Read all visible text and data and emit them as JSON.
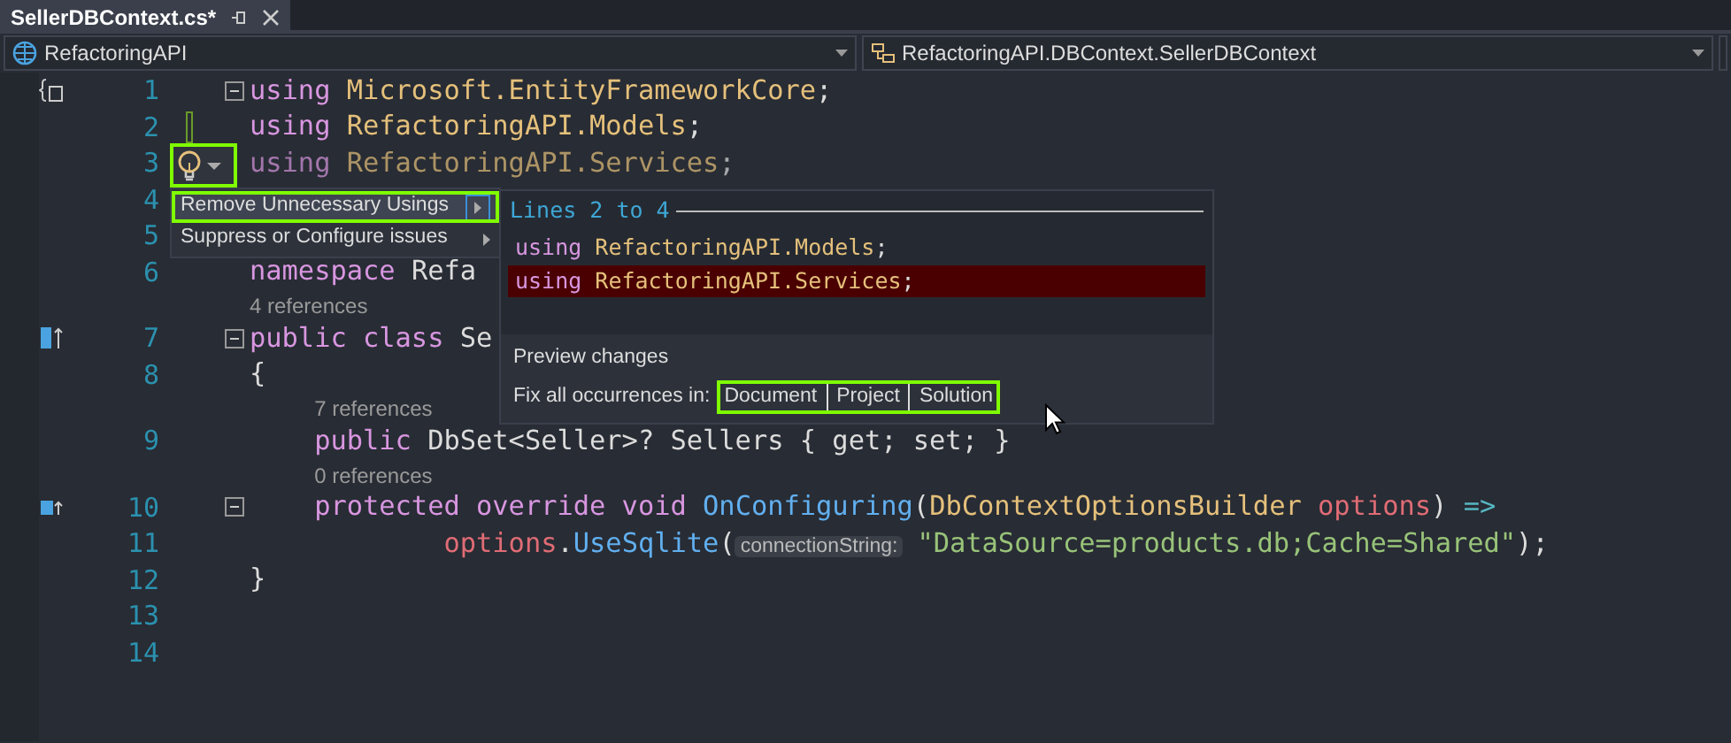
{
  "tab": {
    "title": "SellerDBContext.cs*",
    "selected": true
  },
  "navigation": {
    "project": "RefactoringAPI",
    "member": "RefactoringAPI.DBContext.SellerDBContext"
  },
  "lines": [
    {
      "kind": "code",
      "number": "1",
      "margin_icon": {
        "kind": "namespace"
      },
      "collapsible": true,
      "changed": false,
      "faded": false,
      "tokens": [
        {
          "kind": "keyword",
          "t": "using"
        },
        {
          "kind": "type",
          "t": " Microsoft.EntityFrameworkCore"
        },
        {
          "kind": "plain",
          "t": ";"
        }
      ]
    },
    {
      "kind": "code",
      "number": "2",
      "collapsible": false,
      "changed": true,
      "faded": false,
      "tokens": [
        {
          "kind": "keyword",
          "t": "using"
        },
        {
          "kind": "type",
          "t": " RefactoringAPI.Models"
        },
        {
          "kind": "plain",
          "t": ";"
        }
      ]
    },
    {
      "kind": "code",
      "number": "3",
      "collapsible": false,
      "changed": false,
      "faded": true,
      "tokens": [
        {
          "kind": "keyword",
          "t": "using"
        },
        {
          "kind": "type",
          "t": " RefactoringAPI.Services"
        },
        {
          "kind": "plain",
          "t": ";"
        }
      ]
    },
    {
      "kind": "code",
      "number": "4",
      "collapsible": false,
      "changed": false,
      "faded": false
    },
    {
      "kind": "code",
      "number": "5",
      "collapsible": false,
      "changed": false,
      "faded": false
    },
    {
      "kind": "code",
      "number": "6",
      "collapsible": false,
      "changed": false,
      "faded": false,
      "tokens": [
        {
          "kind": "keyword",
          "t": "namespace"
        },
        {
          "kind": "plain",
          "t": " Refa"
        }
      ]
    },
    {
      "kind": "lens",
      "text": "4 references"
    },
    {
      "kind": "code",
      "number": "7",
      "margin_icon": {
        "kind": "implemented"
      },
      "collapsible": true,
      "changed": false,
      "faded": false,
      "tokens": [
        {
          "kind": "keyword",
          "t": "public class"
        },
        {
          "kind": "plain",
          "t": " Se"
        }
      ]
    },
    {
      "kind": "code",
      "number": "8",
      "collapsible": false,
      "changed": false,
      "faded": false,
      "tokens": [
        {
          "kind": "plain",
          "t": "{"
        }
      ]
    },
    {
      "kind": "lens",
      "text": "    7 references"
    },
    {
      "kind": "code",
      "number": "9",
      "collapsible": false,
      "changed": false,
      "faded": false,
      "tokens": [
        {
          "kind": "keyword",
          "t": "    public"
        },
        {
          "kind": "plain",
          "t": " DbSet<Seller>? Sellers { get; set; }"
        }
      ]
    },
    {
      "kind": "lens",
      "text": "    0 references"
    },
    {
      "kind": "code",
      "number": "10",
      "margin_icon": {
        "kind": "override"
      },
      "collapsible": true,
      "changed": false,
      "faded": false,
      "tokens": [
        {
          "kind": "keyword",
          "t": "    protected override void"
        },
        {
          "kind": "method",
          "t": " OnConfiguring"
        },
        {
          "kind": "plain",
          "t": "("
        },
        {
          "kind": "type",
          "t": "DbContextOptionsBuilder"
        },
        {
          "kind": "param",
          "t": " options"
        },
        {
          "kind": "plain",
          "t": ") "
        },
        {
          "kind": "operator",
          "t": "=>"
        }
      ]
    },
    {
      "kind": "code",
      "number": "11",
      "collapsible": false,
      "changed": false,
      "faded": false,
      "tokens": [
        {
          "kind": "param",
          "t": "            options"
        },
        {
          "kind": "plain",
          "t": "."
        },
        {
          "kind": "method",
          "t": "UseSqlite"
        },
        {
          "kind": "plain",
          "t": "("
        },
        {
          "kind": "hint",
          "t": "connectionString:"
        },
        {
          "kind": "string",
          "t": "\"DataSource=products.db;Cache=Shared\""
        },
        {
          "kind": "plain",
          "t": ");"
        }
      ]
    },
    {
      "kind": "code",
      "number": "12",
      "collapsible": false,
      "changed": false,
      "faded": false,
      "tokens": [
        {
          "kind": "plain",
          "t": "}"
        }
      ]
    },
    {
      "kind": "code",
      "number": "13",
      "collapsible": false,
      "changed": false,
      "faded": false
    },
    {
      "kind": "code",
      "number": "14",
      "collapsible": false,
      "changed": false,
      "faded": false
    }
  ],
  "lightbulb": {
    "highlighted": true
  },
  "quick_actions": [
    {
      "label": "Remove Unnecessary Usings",
      "selected": true,
      "highlighted": true
    },
    {
      "label": "Suppress or Configure issues",
      "selected": false,
      "highlighted": false
    }
  ],
  "preview": {
    "heading": "Lines 2 to 4",
    "lines": [
      {
        "removed": false,
        "tokens": [
          {
            "kind": "keyword",
            "t": "using"
          },
          {
            "kind": "type",
            "t": " RefactoringAPI.Models"
          },
          {
            "kind": "plain",
            "t": ";"
          }
        ]
      },
      {
        "removed": true,
        "tokens": [
          {
            "kind": "keyword",
            "t": "using"
          },
          {
            "kind": "type",
            "t": " RefactoringAPI.Services"
          },
          {
            "kind": "plain",
            "t": ";"
          }
        ]
      }
    ],
    "preview_link": "Preview changes",
    "fix_all_label": "Fix all occurrences in:",
    "scopes": [
      "Document",
      "Project",
      "Solution"
    ],
    "scopes_highlighted": true
  }
}
